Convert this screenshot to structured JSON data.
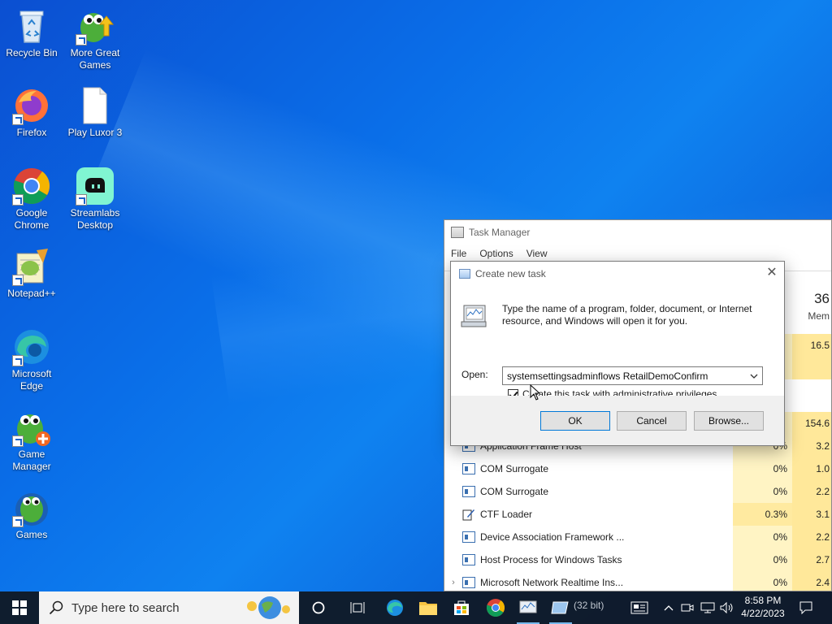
{
  "desktop": {
    "icons": [
      {
        "label": "Recycle Bin"
      },
      {
        "label": "More Great Games"
      },
      {
        "label": "Firefox"
      },
      {
        "label": "Play Luxor 3"
      },
      {
        "label": "Google Chrome"
      },
      {
        "label": "Streamlabs Desktop"
      },
      {
        "label": "Notepad++"
      },
      {
        "label": "Microsoft Edge"
      },
      {
        "label": "Game Manager"
      },
      {
        "label": "Games"
      }
    ]
  },
  "task_manager": {
    "title": "Task Manager",
    "menu": [
      "File",
      "Options",
      "View"
    ],
    "header_percent": "36",
    "header_mem": "Mem",
    "partial_rows": [
      {
        "cpu": "",
        "mem": "16.5"
      },
      {
        "cpu": "",
        "mem": "154.6"
      }
    ],
    "processes": [
      {
        "name": "Application Frame Host",
        "cpu": "0%",
        "mem": "3.2"
      },
      {
        "name": "COM Surrogate",
        "cpu": "0%",
        "mem": "1.0"
      },
      {
        "name": "COM Surrogate",
        "cpu": "0%",
        "mem": "2.2"
      },
      {
        "name": "CTF Loader",
        "cpu": "0.3%",
        "mem": "3.1"
      },
      {
        "name": "Device Association Framework ...",
        "cpu": "0%",
        "mem": "2.2"
      },
      {
        "name": "Host Process for Windows Tasks",
        "cpu": "0%",
        "mem": "2.7"
      },
      {
        "name": "Microsoft Network Realtime Ins...",
        "cpu": "0%",
        "mem": "2.4"
      }
    ]
  },
  "dialog": {
    "title": "Create new task",
    "description": "Type the name of a program, folder, document, or Internet resource, and Windows will open it for you.",
    "open_label": "Open:",
    "open_value": "systemsettingsadminflows RetailDemoConfirm",
    "checkbox_label": "Create this task with administrative privileges.",
    "checkbox_checked": true,
    "ok_label": "OK",
    "cancel_label": "Cancel",
    "browse_label": "Browse..."
  },
  "taskbar": {
    "search_placeholder": "Type here to search",
    "hidden_app_text": "(32 bit)",
    "clock_time": "8:58 PM",
    "clock_date": "4/22/2023"
  }
}
